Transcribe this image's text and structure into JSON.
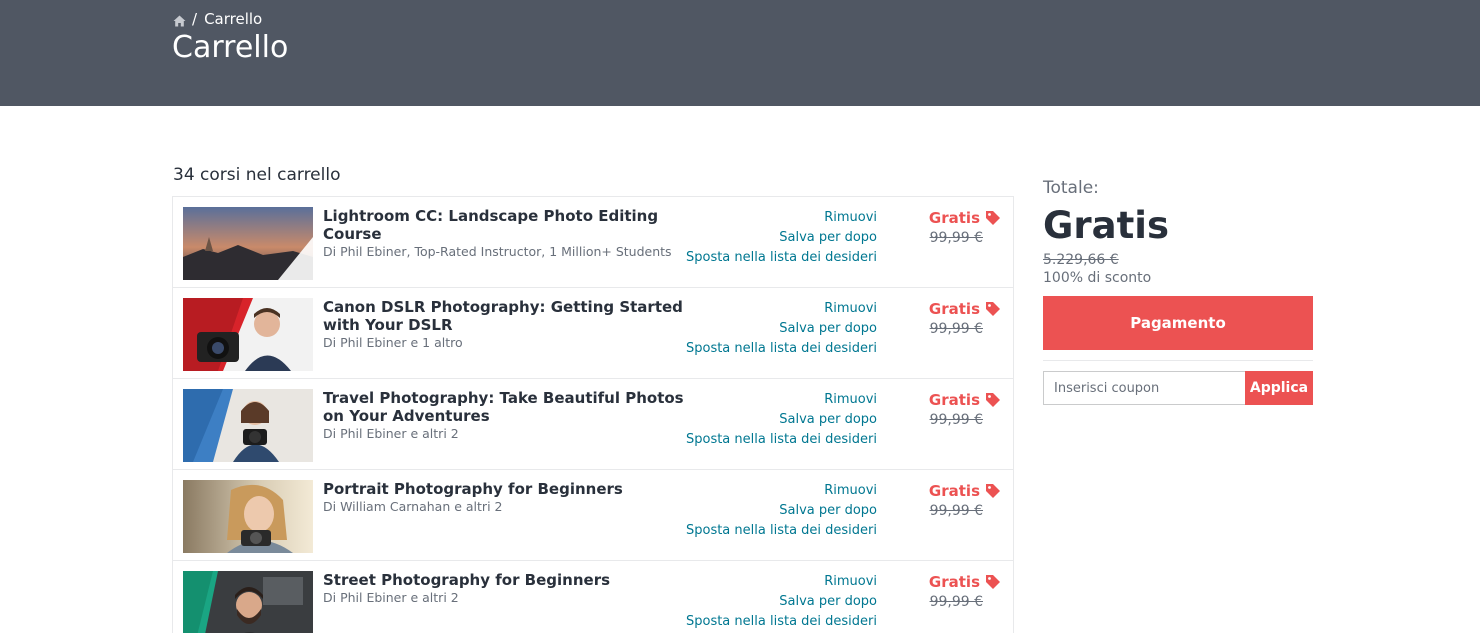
{
  "header": {
    "breadcrumb": {
      "separator": "/",
      "current": "Carrello"
    },
    "title": "Carrello"
  },
  "cart": {
    "count_text": "34 corsi nel carrello",
    "items": [
      {
        "title": "Lightroom CC: Landscape Photo Editing Course",
        "author": "Di Phil Ebiner, Top-Rated Instructor, 1 Million+ Students",
        "remove": "Rimuovi",
        "save": "Salva per dopo",
        "wishlist": "Sposta nella lista dei desideri",
        "price": "Gratis",
        "old_price": "99,99 €"
      },
      {
        "title": "Canon DSLR Photography: Getting Started with Your DSLR",
        "author": "Di Phil Ebiner e 1 altro",
        "remove": "Rimuovi",
        "save": "Salva per dopo",
        "wishlist": "Sposta nella lista dei desideri",
        "price": "Gratis",
        "old_price": "99,99 €"
      },
      {
        "title": "Travel Photography: Take Beautiful Photos on Your Adventures",
        "author": "Di Phil Ebiner e altri 2",
        "remove": "Rimuovi",
        "save": "Salva per dopo",
        "wishlist": "Sposta nella lista dei desideri",
        "price": "Gratis",
        "old_price": "99,99 €"
      },
      {
        "title": "Portrait Photography for Beginners",
        "author": "Di William Carnahan e altri 2",
        "remove": "Rimuovi",
        "save": "Salva per dopo",
        "wishlist": "Sposta nella lista dei desideri",
        "price": "Gratis",
        "old_price": "99,99 €"
      },
      {
        "title": "Street Photography for Beginners",
        "author": "Di Phil Ebiner e altri 2",
        "remove": "Rimuovi",
        "save": "Salva per dopo",
        "wishlist": "Sposta nella lista dei desideri",
        "price": "Gratis",
        "old_price": "99,99 €"
      }
    ]
  },
  "summary": {
    "total_label": "Totale:",
    "total": "Gratis",
    "old_total": "5.229,66 €",
    "discount": "100% di sconto",
    "checkout_label": "Pagamento",
    "coupon_placeholder": "Inserisci coupon",
    "coupon_apply": "Applica"
  },
  "icons": {
    "breadcrumb_home": "home-icon",
    "price_tag": "price-tag-icon"
  },
  "colors": {
    "header_bg": "#505763",
    "accent_red": "#ec5252",
    "link_teal": "#007791",
    "text_dark": "#29303b",
    "text_muted": "#686f7a"
  }
}
